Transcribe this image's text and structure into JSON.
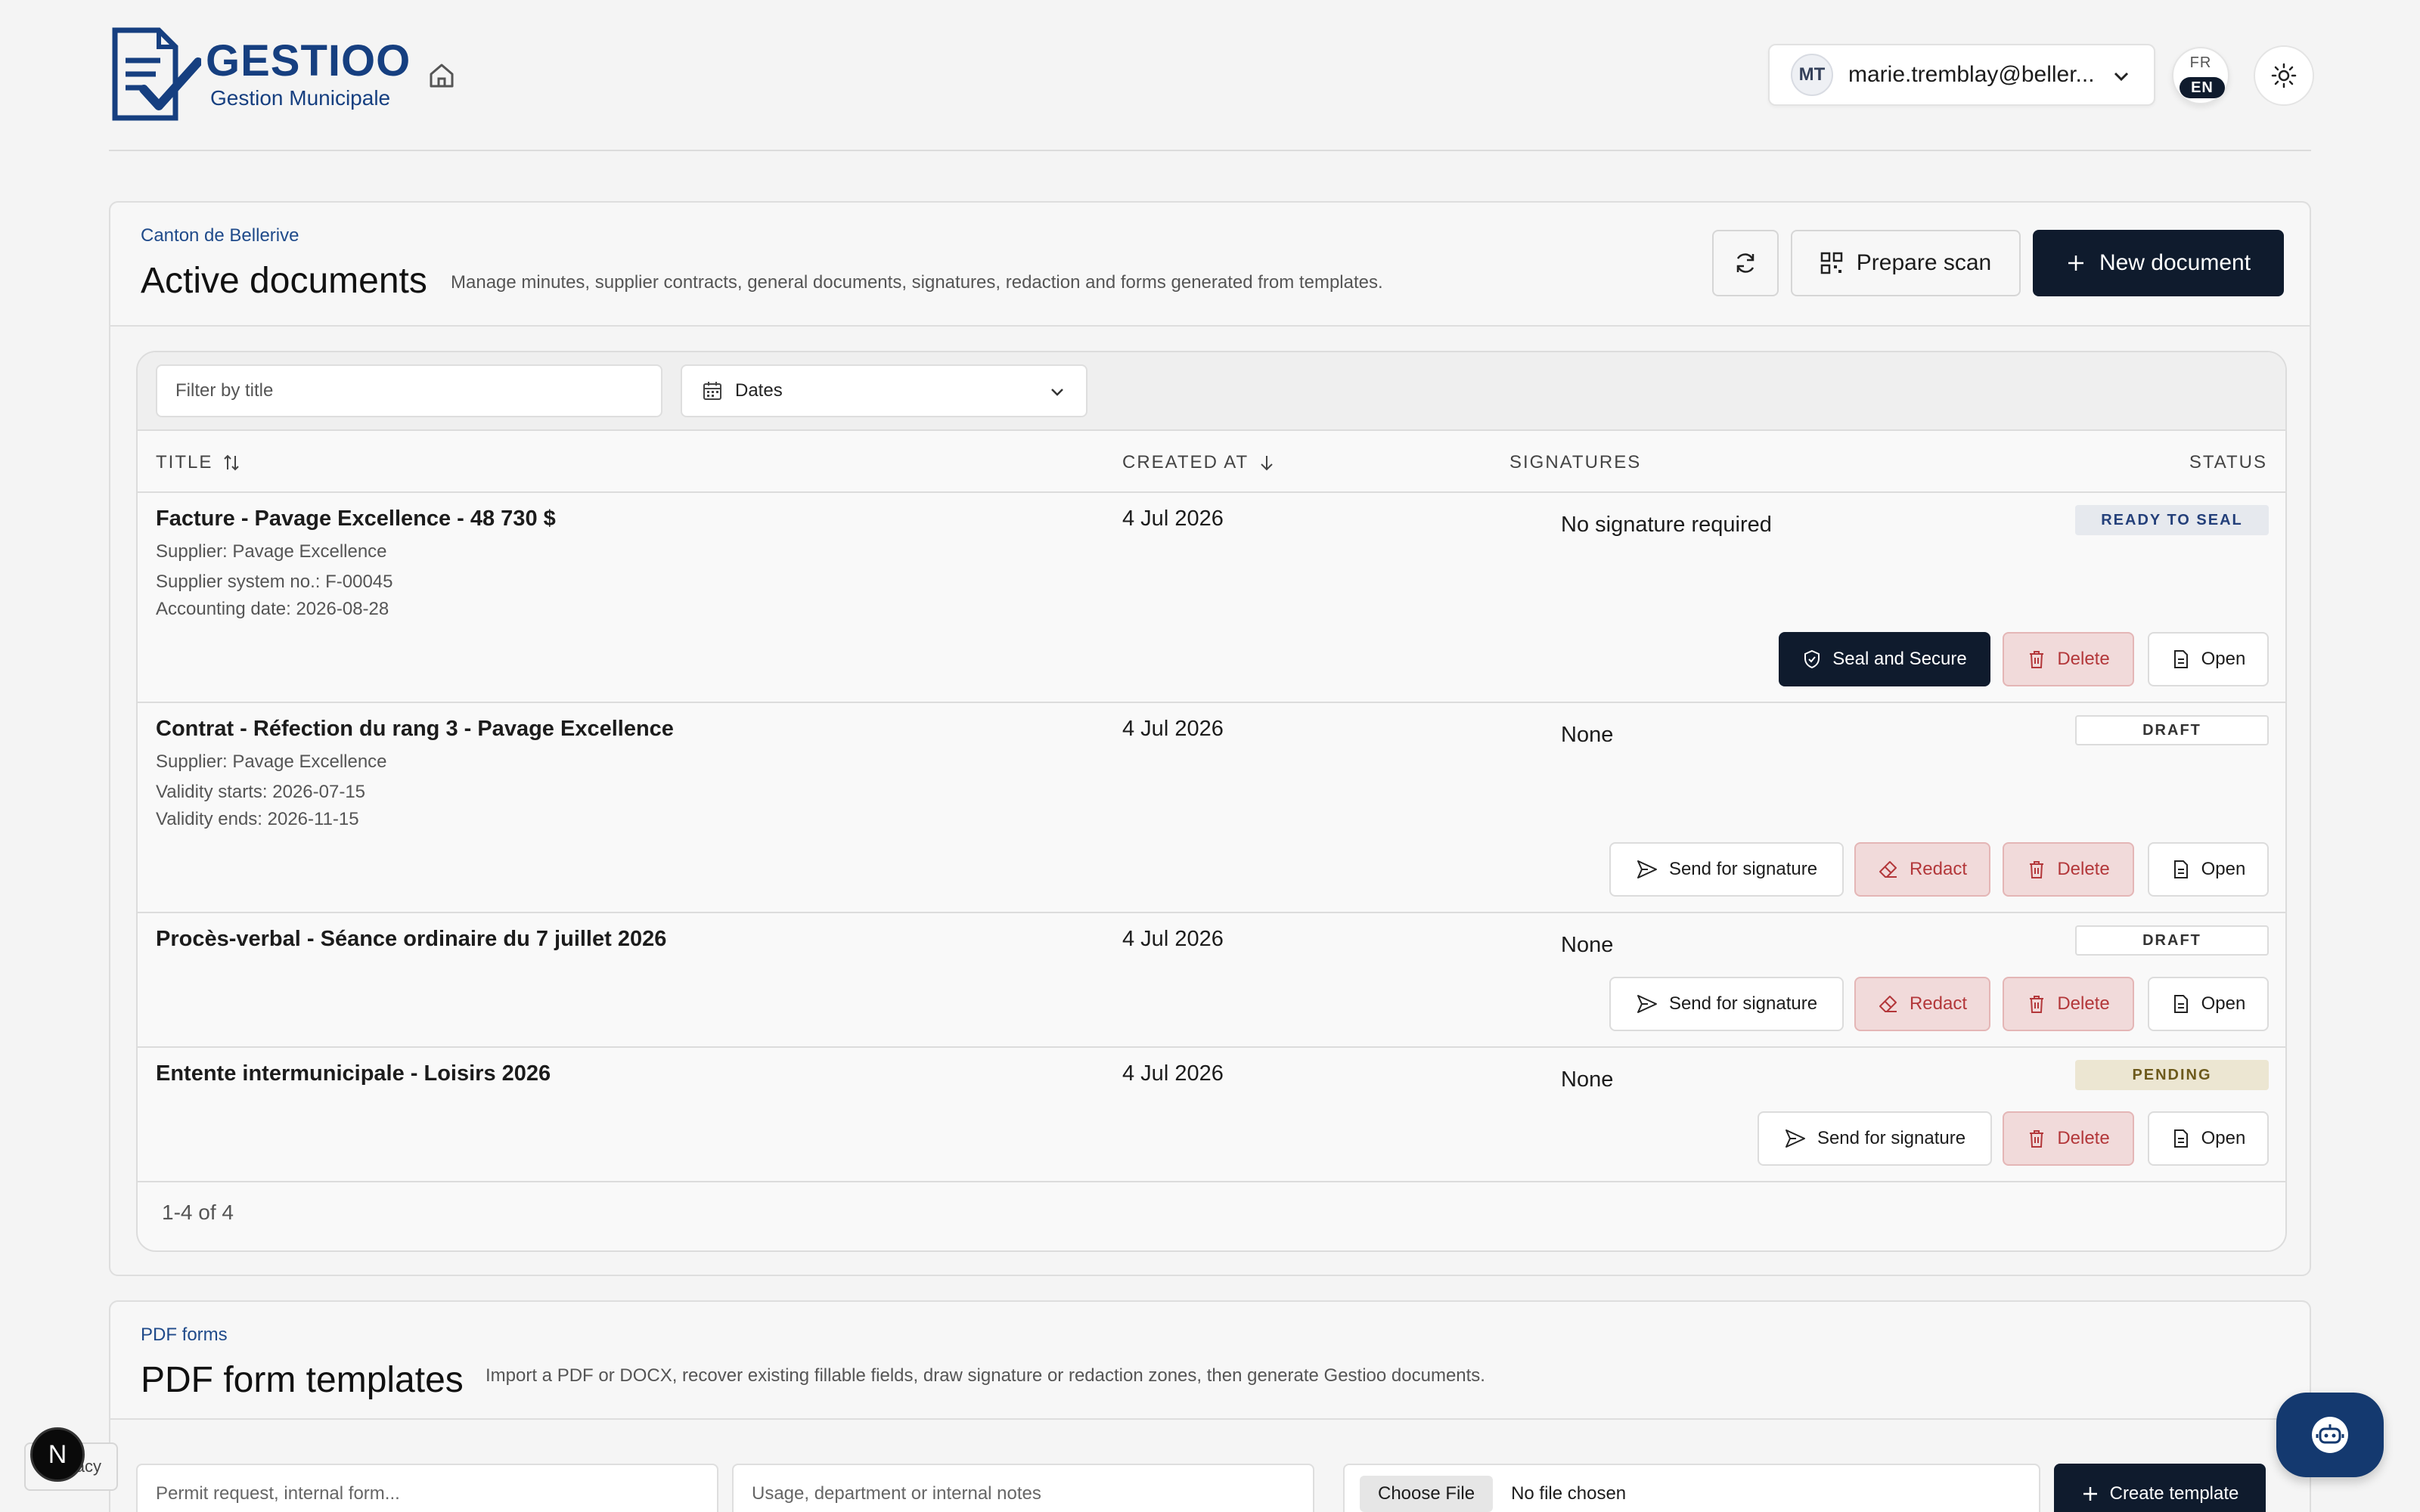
{
  "header": {
    "brand_title": "GESTIOO",
    "brand_subtitle": "Gestion Municipale",
    "account": {
      "initials": "MT",
      "email": "marie.tremblay@beller..."
    },
    "lang": {
      "inactive": "FR",
      "active": "EN"
    }
  },
  "documents": {
    "eyebrow": "Canton de Bellerive",
    "title": "Active documents",
    "description": "Manage minutes, supplier contracts, general documents, signatures, redaction and forms generated from templates.",
    "prepare_scan_label": "Prepare scan",
    "new_document_label": "New document",
    "filter_placeholder": "Filter by title",
    "dates_label": "Dates",
    "columns": {
      "title": "TITLE",
      "created_at": "CREATED AT",
      "signatures": "SIGNATURES",
      "status": "STATUS"
    },
    "rows": [
      {
        "title": "Facture - Pavage Excellence - 48 730 $",
        "meta": [
          "Supplier: Pavage Excellence",
          "Supplier system no.: F-00045",
          "Accounting date: 2026-08-28"
        ],
        "created_at": "4 Jul 2026",
        "signatures": "No signature required",
        "status": "READY TO SEAL",
        "actions": {
          "seal": "Seal and Secure",
          "delete": "Delete",
          "open": "Open"
        }
      },
      {
        "title": "Contrat - Réfection du rang 3 - Pavage Excellence",
        "meta": [
          "Supplier: Pavage Excellence",
          "Validity starts: 2026-07-15",
          "Validity ends: 2026-11-15"
        ],
        "created_at": "4 Jul 2026",
        "signatures": "None",
        "status": "DRAFT",
        "actions": {
          "send": "Send for signature",
          "redact": "Redact",
          "delete": "Delete",
          "open": "Open"
        }
      },
      {
        "title": "Procès-verbal - Séance ordinaire du 7 juillet 2026",
        "meta": [],
        "created_at": "4 Jul 2026",
        "signatures": "None",
        "status": "DRAFT",
        "actions": {
          "send": "Send for signature",
          "redact": "Redact",
          "delete": "Delete",
          "open": "Open"
        }
      },
      {
        "title": "Entente intermunicipale - Loisirs 2026",
        "meta": [],
        "created_at": "4 Jul 2026",
        "signatures": "None",
        "status": "PENDING",
        "actions": {
          "send": "Send for signature",
          "delete": "Delete",
          "open": "Open"
        }
      }
    ],
    "pagination": "1-4 of 4"
  },
  "templates": {
    "eyebrow": "PDF forms",
    "title": "PDF form templates",
    "description": "Import a PDF or DOCX, recover existing fillable fields, draw signature or redaction zones, then generate Gestioo documents.",
    "name_placeholder": "Permit request, internal form...",
    "notes_placeholder": "Usage, department or internal notes",
    "choose_file_label": "Choose File",
    "no_file_label": "No file chosen",
    "create_label": "Create template"
  },
  "floating": {
    "privacy_label": "Privacy",
    "dev_badge": "N"
  },
  "colors": {
    "brand": "#163f80",
    "primary_button": "#0f1b2d",
    "danger": "#b3373a",
    "danger_bg": "#f1dada"
  }
}
